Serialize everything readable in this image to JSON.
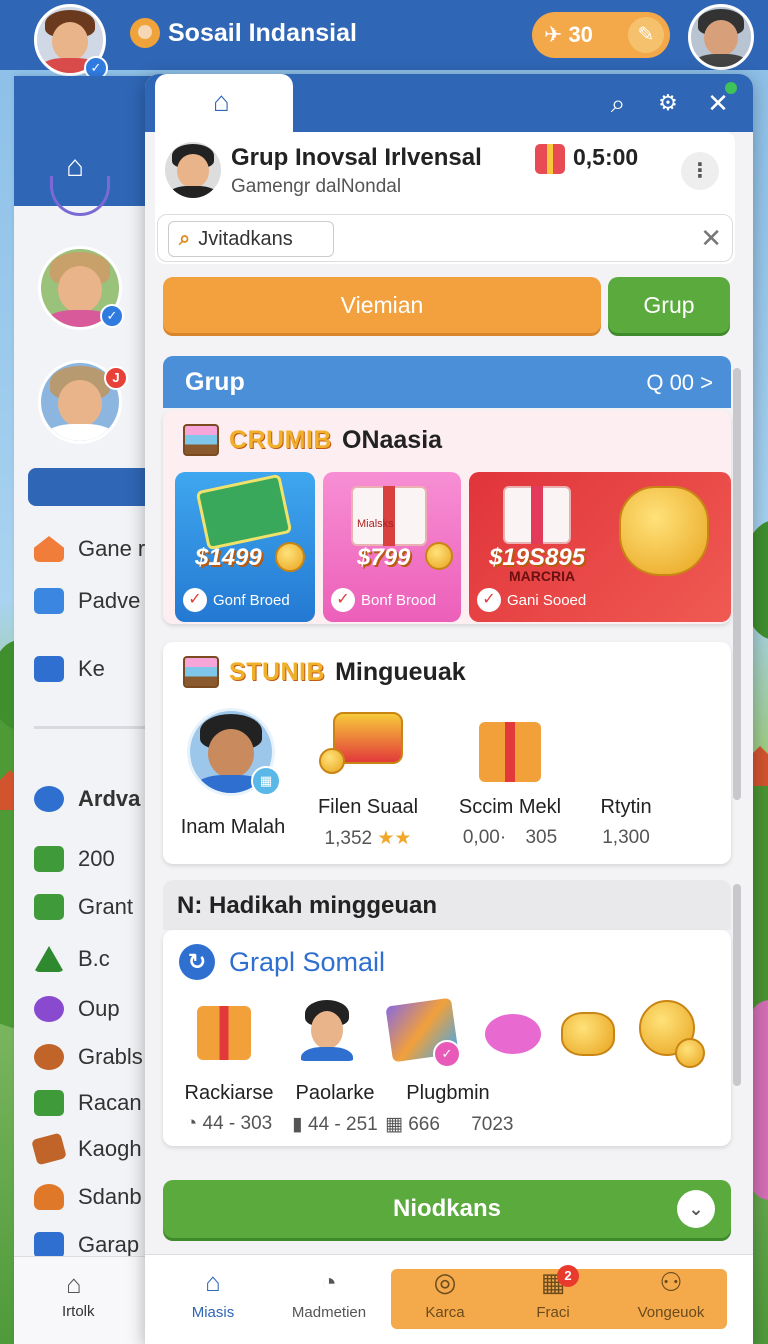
{
  "topbar": {
    "title": "Sosail Indansial",
    "coins": "30"
  },
  "sidebar": {
    "items": [
      {
        "label": "Gane r",
        "icon": "house-icon"
      },
      {
        "label": "Padve",
        "icon": "message-icon"
      },
      {
        "label": "Ke",
        "icon": "id-card-icon"
      },
      {
        "label": "Ardva",
        "icon": "gear-icon"
      },
      {
        "label": "200",
        "icon": "basket-icon"
      },
      {
        "label": "Grant",
        "icon": "list-icon"
      },
      {
        "label": "B.c",
        "icon": "tree-icon"
      },
      {
        "label": "Oup",
        "icon": "flower-icon"
      },
      {
        "label": "Grabls",
        "icon": "bear-icon"
      },
      {
        "label": "Racan",
        "icon": "gift-icon"
      },
      {
        "label": "Kaogh",
        "icon": "ticket-icon"
      },
      {
        "label": "Sdanb",
        "icon": "bag-icon"
      },
      {
        "label": "Garap",
        "icon": "briefcase-icon"
      }
    ],
    "avatar_badge": "J",
    "bottom_label": "Irtolk"
  },
  "group": {
    "title": "Grup Inovsal Irlvensal",
    "subtitle": "Gamengr dalNondal",
    "timer": "0,5:00",
    "search_chip": "Jvitadkans"
  },
  "actions": {
    "primary": "Viemian",
    "secondary": "Grup"
  },
  "section_grup": {
    "title": "Grup",
    "right": "Q 00 >"
  },
  "offers_card": {
    "badge": "CRUMIB",
    "title": "ONaasia",
    "offers": [
      {
        "price": "$1499",
        "label": "Gonf Broed",
        "color": "#2f8fe0"
      },
      {
        "price": "$799",
        "label": "Bonf Brood",
        "color": "#f06ac0"
      },
      {
        "price": "$19S895",
        "brand": "MARCRIA",
        "label": "Gani Sooed",
        "color": "#e23b3b"
      }
    ],
    "brand_on_gift": "Mialsks"
  },
  "weekly_card": {
    "badge": "STUNIB",
    "title": "Mingueuak",
    "people": [
      {
        "name": "Inam Malah",
        "stat": ""
      },
      {
        "name": "Filen Suaal",
        "stat": "1,352"
      },
      {
        "name": "Sccim Mekl",
        "stat": "305",
        "stat_prefix": "0,00·"
      },
      {
        "name": "Rtytin",
        "stat": "1,300"
      }
    ]
  },
  "section_gray": {
    "title": "N: Hadikah minggeuan"
  },
  "grapl_card": {
    "title": "Grapl Somail",
    "people": [
      {
        "name": "Rackiarse",
        "stat": "44 - 303"
      },
      {
        "name": "Paolarke",
        "stat": "44 - 251"
      },
      {
        "name": "Plugbmin",
        "stat": "666",
        "extra": "7023"
      }
    ]
  },
  "bottom_button": "Niodkans",
  "bottom_nav": [
    {
      "label": "Miasis",
      "icon": "home-icon",
      "active": true
    },
    {
      "label": "Madmetien",
      "icon": "clock-icon"
    },
    {
      "label": "Karca",
      "icon": "target-icon"
    },
    {
      "label": "Fraci",
      "icon": "calendar-icon",
      "badge": "2"
    },
    {
      "label": "Vongeuok",
      "icon": "people-icon"
    }
  ],
  "colors": {
    "brand_blue": "#2f66b5",
    "orange": "#f3a13e",
    "green": "#5aaa3d"
  }
}
